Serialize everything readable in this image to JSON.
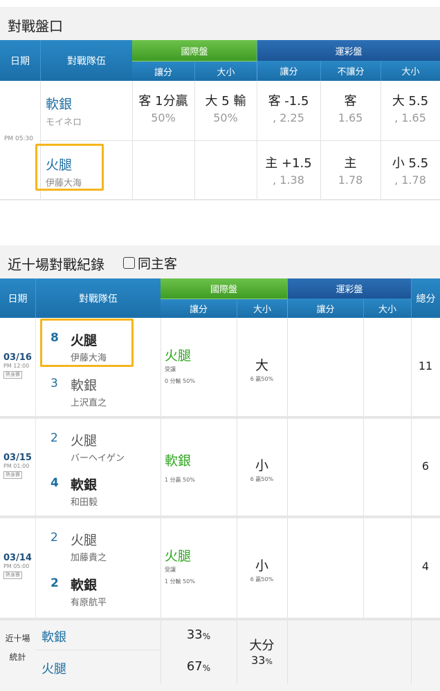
{
  "odds": {
    "title": "對戰盤口",
    "header": {
      "date": "日期",
      "teams": "對戰隊伍",
      "intl": "國際盤",
      "intl_spread": "讓分",
      "intl_total": "大小",
      "lottery": "運彩盤",
      "lot_spread": "讓分",
      "lot_nospread": "不讓分",
      "lot_total": "大小"
    },
    "time": "PM 05:30",
    "away": {
      "team": "軟銀",
      "pitcher": "モイネロ",
      "intl_spread": "客 1分贏",
      "intl_spread_pct": "50%",
      "intl_total": "大 5 輸",
      "intl_total_pct": "50%",
      "lot_spread": "客 -1.5",
      "lot_spread_odds": ", 2.25",
      "lot_nospread": "客",
      "lot_nospread_odds": "1.65",
      "lot_total": "大 5.5",
      "lot_total_odds": ", 1.65"
    },
    "home": {
      "team": "火腿",
      "pitcher": "伊藤大海",
      "lot_spread": "主 +1.5",
      "lot_spread_odds": ", 1.38",
      "lot_nospread": "主",
      "lot_nospread_odds": "1.78",
      "lot_total": "小 5.5",
      "lot_total_odds": ", 1.78"
    }
  },
  "history": {
    "title": "近十場對戰紀錄",
    "checkbox_label": "同主客",
    "header": {
      "date": "日期",
      "teams": "對戰隊伍",
      "intl": "國際盤",
      "intl_spread": "讓分",
      "intl_total": "大小",
      "lottery": "運彩盤",
      "lot_spread": "讓分",
      "lot_total": "大小",
      "total": "總分"
    },
    "badge": "熱身賽",
    "games": [
      {
        "date": "03/16",
        "time": "PM 12:00",
        "t1_score": "8",
        "t1_team": "火腿",
        "t1_pitcher": "伊藤大海",
        "t2_score": "3",
        "t2_team": "軟銀",
        "t2_pitcher": "上沢直之",
        "spread_team": "火腿",
        "spread_note": "受讓",
        "spread_result": "0 分輸 50%",
        "total": "大",
        "total_note": "6 贏50%",
        "sum": "11"
      },
      {
        "date": "03/15",
        "time": "PM 01:00",
        "t1_score": "2",
        "t1_team": "火腿",
        "t1_pitcher": "バーヘイゲン",
        "t2_score": "4",
        "t2_team": "軟銀",
        "t2_pitcher": "和田毅",
        "spread_team": "軟銀",
        "spread_note": "",
        "spread_result": "1 分贏 50%",
        "total": "小",
        "total_note": "6 贏50%",
        "sum": "6"
      },
      {
        "date": "03/14",
        "time": "PM 05:00",
        "t1_score": "2",
        "t1_team": "火腿",
        "t1_pitcher": "加藤貴之",
        "t2_score": "2",
        "t2_team": "軟銀",
        "t2_pitcher": "有原航平",
        "spread_team": "火腿",
        "spread_note": "受讓",
        "spread_result": "1 分輸 50%",
        "total": "小",
        "total_note": "6 贏50%",
        "sum": "4"
      }
    ],
    "stats": {
      "label1": "近十場",
      "label2": "統計",
      "team1": "軟銀",
      "team1_pct": "33",
      "team2": "火腿",
      "team2_pct": "67",
      "pct_sign": "%",
      "total_label": "大分",
      "total_pct": "33"
    }
  }
}
